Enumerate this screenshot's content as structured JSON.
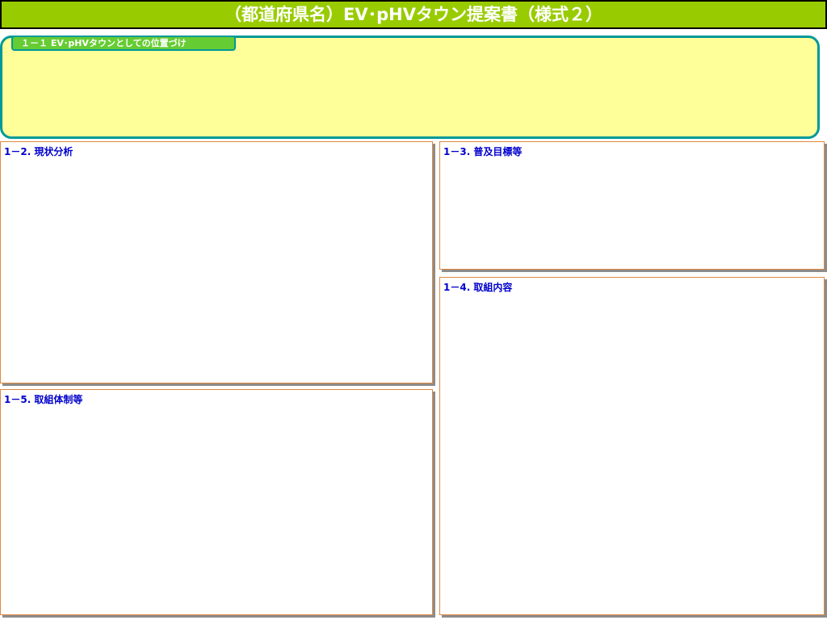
{
  "slide": {
    "title": "（都道府県名）EV･pHVタウン提案書（様式２）",
    "section_1_1": {
      "label": "１－１ EV･pHVタウンとしての位置づけ"
    },
    "section_1_2": {
      "heading": "1－2. 現状分析"
    },
    "section_1_3": {
      "heading": "1－3. 普及目標等"
    },
    "section_1_4": {
      "heading": "1－4. 取組内容"
    },
    "section_1_5": {
      "heading": "1－5. 取組体制等"
    }
  },
  "colors": {
    "title_bar_bg": "#99cc00",
    "section_1_1_bg": "#ffff99",
    "section_1_1_border": "#009999",
    "label_bg": "#66cc33",
    "heading_text": "#0000cc",
    "panel_border": "#e08a40",
    "panel_shadow": "#8c8c8c"
  }
}
